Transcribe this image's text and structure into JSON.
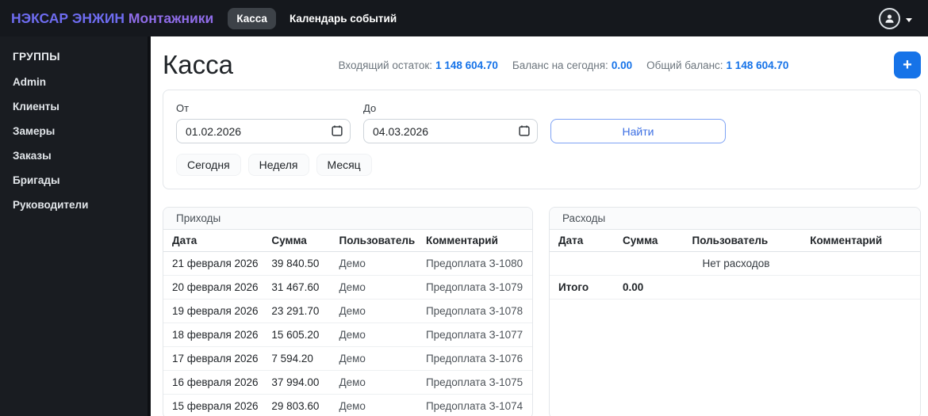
{
  "brand": {
    "part1": "НЭКСАР ЭНЖИН",
    "part2": "Монтажники"
  },
  "navbar": {
    "tabs": [
      {
        "label": "Касса",
        "active": true
      },
      {
        "label": "Календарь событий",
        "active": false
      }
    ]
  },
  "sidebar": {
    "title": "ГРУППЫ",
    "items": [
      "Admin",
      "Клиенты",
      "Замеры",
      "Заказы",
      "Бригады",
      "Руководители"
    ]
  },
  "header": {
    "title": "Касса",
    "stats": [
      {
        "label": "Входящий остаток:",
        "value": "1 148 604.70"
      },
      {
        "label": "Баланс на сегодня:",
        "value": "0.00"
      },
      {
        "label": "Общий баланс:",
        "value": "1 148 604.70"
      }
    ],
    "add_button": "+"
  },
  "filter": {
    "from_label": "От",
    "from_value": "01.02.2026",
    "to_label": "До",
    "to_value": "04.03.2026",
    "search_button": "Найти",
    "quick_buttons": [
      "Сегодня",
      "Неделя",
      "Месяц"
    ]
  },
  "income": {
    "title": "Приходы",
    "columns": [
      "Дата",
      "Сумма",
      "Пользователь",
      "Комментарий"
    ],
    "rows": [
      [
        "21 февраля 2026",
        "39 840.50",
        "Демо",
        "Предоплата З-1080"
      ],
      [
        "20 февраля 2026",
        "31 467.60",
        "Демо",
        "Предоплата З-1079"
      ],
      [
        "19 февраля 2026",
        "23 291.70",
        "Демо",
        "Предоплата З-1078"
      ],
      [
        "18 февраля 2026",
        "15 605.20",
        "Демо",
        "Предоплата З-1077"
      ],
      [
        "17 февраля 2026",
        "7 594.20",
        "Демо",
        "Предоплата З-1076"
      ],
      [
        "16 февраля 2026",
        "37 994.00",
        "Демо",
        "Предоплата З-1075"
      ],
      [
        "15 февраля 2026",
        "29 803.60",
        "Демо",
        "Предоплата З-1074"
      ]
    ]
  },
  "expense": {
    "title": "Расходы",
    "columns": [
      "Дата",
      "Сумма",
      "Пользователь",
      "Комментарий"
    ],
    "empty_text": "Нет расходов",
    "total_label": "Итого",
    "total_value": "0.00"
  },
  "colors": {
    "accent": "#1673e8",
    "navbar_bg": "#15181d",
    "sidebar_bg": "#191c21",
    "tab_active_bg": "#3d4248",
    "brand_start": "#6e6cf0",
    "brand_end": "#8f6ce8",
    "outline_border": "#7ea2f4",
    "outline_text": "#3c6fe3",
    "card_border": "#e3e6ea"
  }
}
